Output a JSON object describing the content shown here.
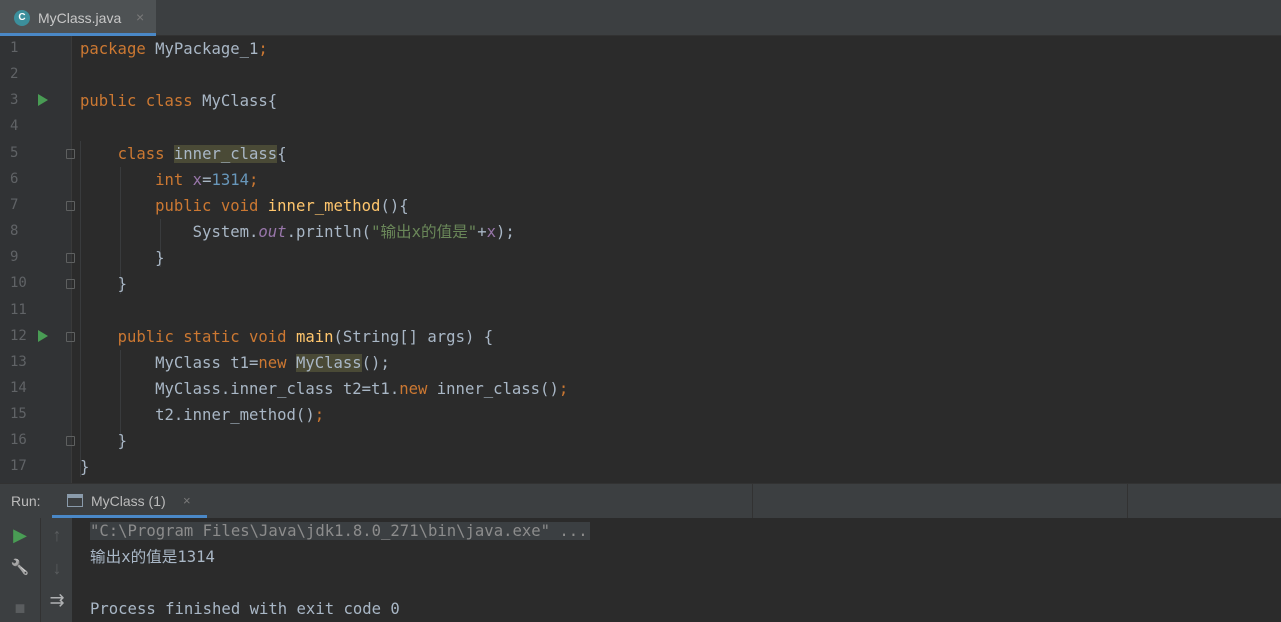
{
  "editor_tab": {
    "icon_letter": "C",
    "filename": "MyClass.java",
    "close": "×"
  },
  "gutter": {
    "line_numbers": [
      "1",
      "2",
      "3",
      "4",
      "5",
      "6",
      "7",
      "8",
      "9",
      "10",
      "11",
      "12",
      "13",
      "14",
      "15",
      "16",
      "17"
    ],
    "run_markers_on_lines": [
      3,
      12
    ],
    "fold_markers_on_lines": [
      5,
      7,
      9,
      10,
      12,
      16
    ]
  },
  "code_lines": [
    [
      {
        "t": "package ",
        "c": "kw"
      },
      {
        "t": "MyPackage_1",
        "c": "txt"
      },
      {
        "t": ";",
        "c": "kw"
      }
    ],
    [],
    [
      {
        "t": "public class ",
        "c": "kw"
      },
      {
        "t": "MyClass{",
        "c": "txt"
      }
    ],
    [],
    [
      {
        "t": "    "
      },
      {
        "t": "class ",
        "c": "kw"
      },
      {
        "t": "inner_class",
        "c": "txt hl"
      },
      {
        "t": "{",
        "c": "txt"
      }
    ],
    [
      {
        "t": "        "
      },
      {
        "t": "int ",
        "c": "kw"
      },
      {
        "t": "x",
        "c": "fld"
      },
      {
        "t": "=",
        "c": "txt"
      },
      {
        "t": "1314",
        "c": "num"
      },
      {
        "t": ";",
        "c": "kw"
      }
    ],
    [
      {
        "t": "        "
      },
      {
        "t": "public void ",
        "c": "kw"
      },
      {
        "t": "inner_method",
        "c": "fn"
      },
      {
        "t": "(){",
        "c": "txt"
      }
    ],
    [
      {
        "t": "            "
      },
      {
        "t": "System.",
        "c": "txt"
      },
      {
        "t": "out",
        "c": "ifld"
      },
      {
        "t": ".println(",
        "c": "txt"
      },
      {
        "t": "\"输出x的值是\"",
        "c": "str"
      },
      {
        "t": "+",
        "c": "txt"
      },
      {
        "t": "x",
        "c": "fld"
      },
      {
        "t": ");",
        "c": "txt"
      }
    ],
    [
      {
        "t": "        "
      },
      {
        "t": "}",
        "c": "txt"
      }
    ],
    [
      {
        "t": "    "
      },
      {
        "t": "}",
        "c": "txt"
      }
    ],
    [],
    [
      {
        "t": "    "
      },
      {
        "t": "public static void ",
        "c": "kw"
      },
      {
        "t": "main",
        "c": "fn"
      },
      {
        "t": "(String[] args) {",
        "c": "txt"
      }
    ],
    [
      {
        "t": "        "
      },
      {
        "t": "MyClass t1=",
        "c": "txt"
      },
      {
        "t": "new ",
        "c": "kw"
      },
      {
        "t": "MyClass",
        "c": "txt hl"
      },
      {
        "t": "();",
        "c": "txt"
      }
    ],
    [
      {
        "t": "        "
      },
      {
        "t": "MyClass.inner_class t2=t1.",
        "c": "txt"
      },
      {
        "t": "new ",
        "c": "kw"
      },
      {
        "t": "inner_class()",
        "c": "txt"
      },
      {
        "t": ";",
        "c": "kw"
      }
    ],
    [
      {
        "t": "        "
      },
      {
        "t": "t2.inner_method()",
        "c": "txt"
      },
      {
        "t": ";",
        "c": "kw"
      }
    ],
    [
      {
        "t": "    "
      },
      {
        "t": "}",
        "c": "txt"
      }
    ],
    [
      {
        "t": "}",
        "c": "txt"
      }
    ]
  ],
  "run_panel": {
    "label": "Run:",
    "tab_label": "MyClass (1)",
    "tab_close": "×",
    "tools_left": [
      {
        "name": "rerun-icon",
        "glyph": "▶",
        "color": "#499c54"
      },
      {
        "name": "wrench-icon",
        "glyph": "🔧",
        "color": "#afb1b3"
      },
      {
        "name": "stop-icon",
        "glyph": "■",
        "color": "#5a5d5f"
      }
    ],
    "tools_right": [
      {
        "name": "up-arrow-icon",
        "glyph": "↑",
        "color": "#5a5d5f"
      },
      {
        "name": "down-arrow-icon",
        "glyph": "↓",
        "color": "#5a5d5f"
      },
      {
        "name": "soft-wrap-icon",
        "glyph": "⇉",
        "color": "#afb1b3"
      }
    ],
    "console_lines": [
      {
        "text": "\"C:\\Program Files\\Java\\jdk1.8.0_271\\bin\\java.exe\" ...",
        "style": "cmd"
      },
      {
        "text": "输出x的值是1314",
        "style": "out"
      },
      {
        "text": "",
        "style": "out"
      },
      {
        "text": "Process finished with exit code 0",
        "style": "out"
      }
    ]
  },
  "colors": {
    "editor_bg": "#2b2b2b",
    "gutter_bg": "#313335",
    "keyword": "#cc7832",
    "function": "#ffc66d",
    "number": "#6897bb",
    "string": "#6a8759",
    "field": "#9876aa",
    "accent": "#4a88c7"
  }
}
